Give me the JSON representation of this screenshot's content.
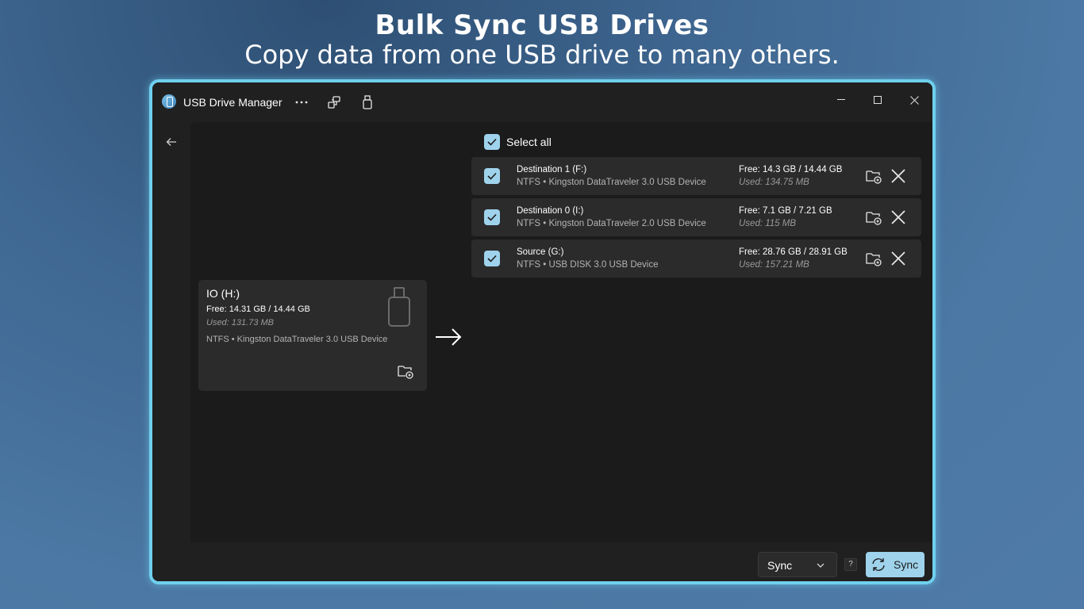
{
  "hero": {
    "title": "Bulk Sync USB Drives",
    "subtitle": "Copy data from one USB drive to many others."
  },
  "titlebar": {
    "app_title": "USB Drive Manager",
    "app_icon": "usb-drive-app-icon",
    "buttons": [
      "more-icon",
      "connected-devices-icon",
      "usb-eject-icon"
    ],
    "window_controls": [
      "minimize-icon",
      "maximize-icon",
      "close-icon"
    ]
  },
  "nav": {
    "back_icon": "back-arrow-icon"
  },
  "source": {
    "name": "IO (H:)",
    "free": "Free: 14.31 GB / 14.44 GB",
    "used": "Used: 131.73 MB",
    "description": "NTFS • Kingston DataTraveler 3.0 USB Device",
    "icon": "usb-drive-icon"
  },
  "destinations": {
    "select_all_label": "Select all",
    "items": [
      {
        "name": "Destination 1 (F:)",
        "desc": "NTFS • Kingston DataTraveler 3.0 USB Device",
        "free": "Free: 14.3 GB / 14.44 GB",
        "used": "Used: 134.75 MB",
        "checked": true
      },
      {
        "name": "Destination 0 (I:)",
        "desc": "NTFS • Kingston DataTraveler 2.0 USB Device",
        "free": "Free: 7.1 GB / 7.21 GB",
        "used": "Used: 115 MB",
        "checked": true
      },
      {
        "name": "Source (G:)",
        "desc": "NTFS • USB DISK 3.0 USB Device",
        "free": "Free: 28.76 GB / 28.91 GB",
        "used": "Used: 157.21 MB",
        "checked": true
      }
    ]
  },
  "footer": {
    "mode_select_value": "Sync",
    "help_label": "?",
    "sync_button_label": "Sync"
  },
  "colors": {
    "accent": "#9fd3ec",
    "window_border": "#6fd0ee",
    "card": "#2b2b2b",
    "panel": "#1b1b1b"
  }
}
